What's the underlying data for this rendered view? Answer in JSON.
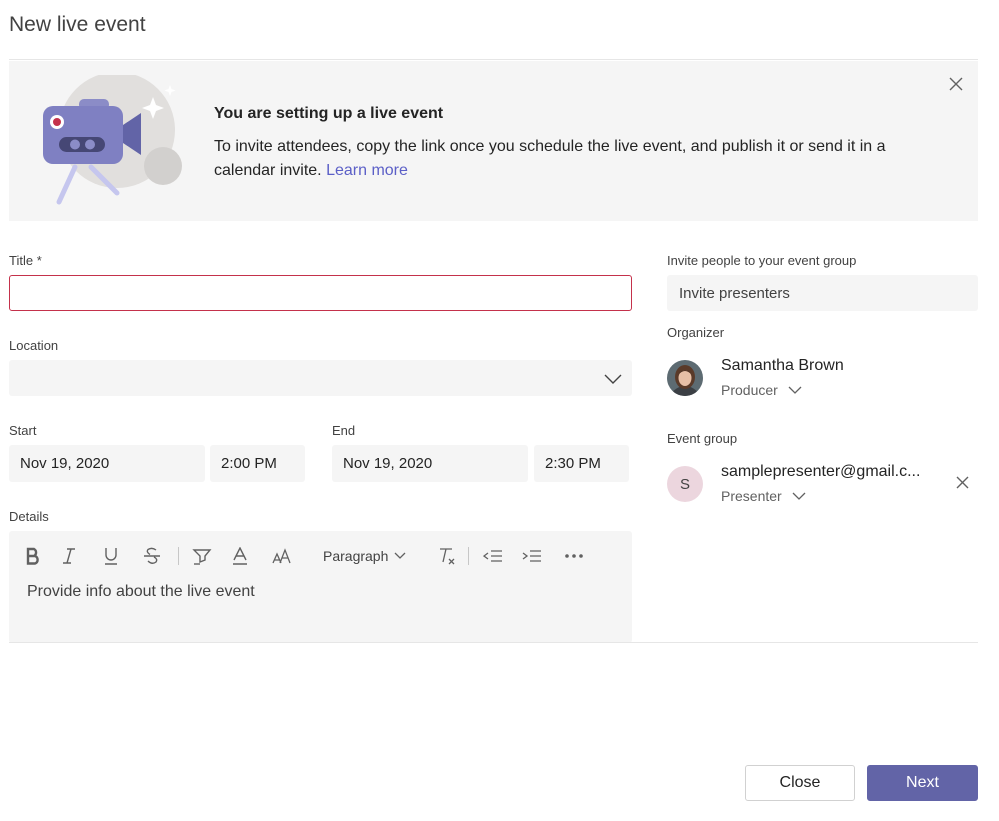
{
  "page": {
    "title": "New live event"
  },
  "banner": {
    "heading": "You are setting up a live event",
    "text": "To invite attendees, copy the link once you schedule the live event, and publish it or send it in a calendar invite.",
    "link": "Learn more",
    "illustration_icon": "camera-illustration",
    "close_icon": "close-icon"
  },
  "form": {
    "title_label": "Title *",
    "title_value": "",
    "location_label": "Location",
    "location_value": "",
    "start_label": "Start",
    "start_date": "Nov 19, 2020",
    "start_time": "2:00 PM",
    "end_label": "End",
    "end_date": "Nov 19, 2020",
    "end_time": "2:30 PM",
    "details_label": "Details",
    "details_placeholder": "Provide info about the live event",
    "paragraph_label": "Paragraph",
    "toolbar_icons": [
      "bold-icon",
      "italic-icon",
      "underline-icon",
      "strikethrough-icon",
      "highlight-icon",
      "font-color-icon",
      "font-size-icon",
      "clear-formatting-icon",
      "decrease-indent-icon",
      "increase-indent-icon",
      "more-options-icon"
    ]
  },
  "invite": {
    "label": "Invite people to your event group",
    "placeholder": "Invite presenters",
    "organizer_label": "Organizer",
    "organizer": {
      "name": "Samantha Brown",
      "role": "Producer"
    },
    "event_group_label": "Event group",
    "member": {
      "initial": "S",
      "email": "samplepresenter@gmail.c...",
      "role": "Presenter"
    }
  },
  "actions": {
    "close_label": "Close",
    "next_label": "Next"
  },
  "colors": {
    "accent": "#6264a7",
    "error_border": "#c4314b",
    "link": "#5b5fc7"
  }
}
